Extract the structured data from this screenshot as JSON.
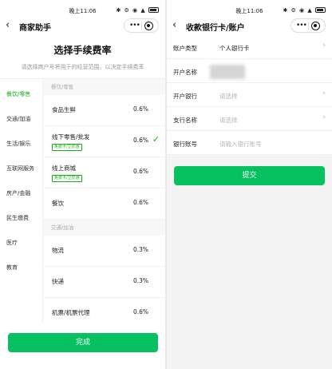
{
  "status": {
    "time": "晚上11:06",
    "icons": "✱ ⚙ ◉ ▲"
  },
  "left": {
    "nav": {
      "title": "商家助手"
    },
    "heading": "选择手续费率",
    "subheading": "请选择商户号将用于的经营范围，以决定手续费率",
    "categories": [
      "餐饮/零售",
      "交通/加油",
      "生活/娱乐",
      "互联网服务",
      "房产/金融",
      "民生缴费",
      "医疗",
      "教育"
    ],
    "groups": [
      {
        "header": "餐饮/零售",
        "items": [
          {
            "name": "食品生鲜",
            "rate": "0.6%",
            "tag": ""
          },
          {
            "name": "线下零售/批发",
            "rate": "0.6%",
            "tag": "免费卡/立优惠"
          },
          {
            "name": "线上商城",
            "rate": "0.6%",
            "tag": "免费卡/立优惠"
          },
          {
            "name": "餐饮",
            "rate": "0.6%",
            "tag": ""
          }
        ]
      },
      {
        "header": "交通/加油",
        "items": [
          {
            "name": "物流",
            "rate": "0.3%",
            "tag": ""
          },
          {
            "name": "快递",
            "rate": "0.3%",
            "tag": ""
          },
          {
            "name": "机票/机票代理",
            "rate": "0.6%",
            "tag": ""
          }
        ]
      }
    ],
    "done_label": "完成"
  },
  "right": {
    "nav": {
      "title": "收款银行卡/账户"
    },
    "rows": {
      "account_type": {
        "label": "账户类型",
        "value": "个人银行卡"
      },
      "account_name": {
        "label": "开户名称"
      },
      "bank": {
        "label": "开户银行",
        "placeholder": "请选择"
      },
      "branch": {
        "label": "支行名称",
        "placeholder": "请选择"
      },
      "account_no": {
        "label": "银行账号",
        "placeholder": "请输入银行账号"
      }
    },
    "submit_label": "提交"
  },
  "colors": {
    "accent": "#07c160",
    "active": "#1aad19"
  },
  "icons": {
    "back": "chevron-left-icon",
    "more": "more-dots-icon",
    "close": "target-circle-icon",
    "check": "checkmark-icon",
    "arrow": "chevron-right-icon"
  }
}
